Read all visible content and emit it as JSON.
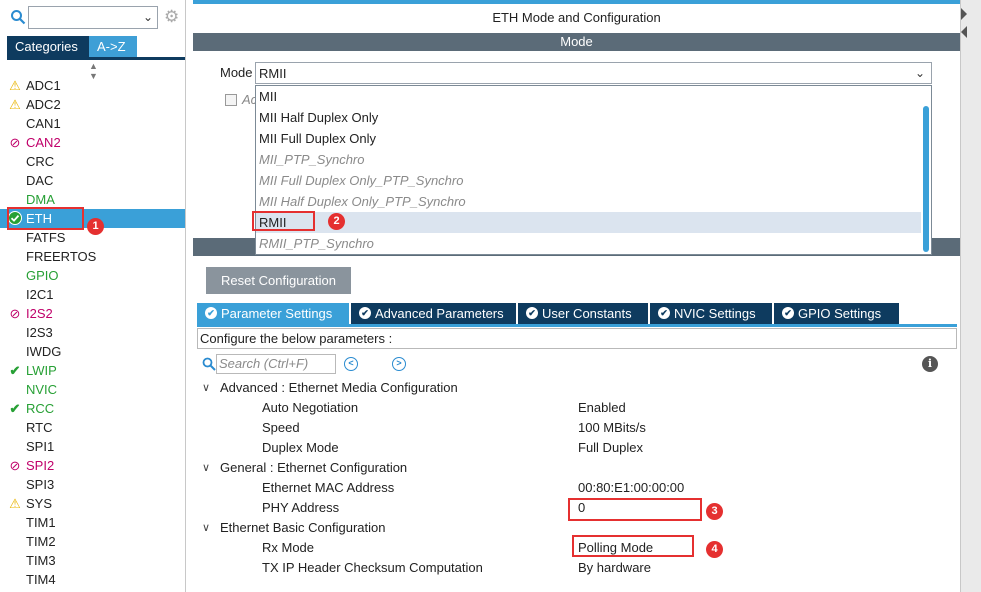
{
  "left_panel": {
    "search": {
      "value": "",
      "placeholder": ""
    },
    "tabs": [
      {
        "label": "Categories"
      },
      {
        "label": "A->Z"
      }
    ],
    "peripherals": [
      {
        "name": "ADC1",
        "status": "warning"
      },
      {
        "name": "ADC2",
        "status": "warning"
      },
      {
        "name": "CAN1",
        "status": "none"
      },
      {
        "name": "CAN2",
        "status": "disabled"
      },
      {
        "name": "CRC",
        "status": "none"
      },
      {
        "name": "DAC",
        "status": "none"
      },
      {
        "name": "DMA",
        "status": "configured-text"
      },
      {
        "name": "ETH",
        "status": "selected-ok"
      },
      {
        "name": "FATFS",
        "status": "none"
      },
      {
        "name": "FREERTOS",
        "status": "none"
      },
      {
        "name": "GPIO",
        "status": "configured-text"
      },
      {
        "name": "I2C1",
        "status": "none"
      },
      {
        "name": "I2S2",
        "status": "disabled"
      },
      {
        "name": "I2S3",
        "status": "none"
      },
      {
        "name": "IWDG",
        "status": "none"
      },
      {
        "name": "LWIP",
        "status": "ok"
      },
      {
        "name": "NVIC",
        "status": "configured-text"
      },
      {
        "name": "RCC",
        "status": "ok"
      },
      {
        "name": "RTC",
        "status": "none"
      },
      {
        "name": "SPI1",
        "status": "none"
      },
      {
        "name": "SPI2",
        "status": "disabled"
      },
      {
        "name": "SPI3",
        "status": "none"
      },
      {
        "name": "SYS",
        "status": "warning"
      },
      {
        "name": "TIM1",
        "status": "none"
      },
      {
        "name": "TIM2",
        "status": "none"
      },
      {
        "name": "TIM3",
        "status": "none"
      },
      {
        "name": "TIM4",
        "status": "none"
      }
    ]
  },
  "main": {
    "title": "ETH Mode and Configuration",
    "mode_header": "Mode",
    "mode_label": "Mode",
    "mode_value": "RMII",
    "behind_text": "Ac",
    "dropdown_options": [
      {
        "label": "MII",
        "italic": false
      },
      {
        "label": "MII Half Duplex Only",
        "italic": false
      },
      {
        "label": "MII Full Duplex Only",
        "italic": false
      },
      {
        "label": "MII_PTP_Synchro",
        "italic": true
      },
      {
        "label": "MII Full Duplex Only_PTP_Synchro",
        "italic": true
      },
      {
        "label": "MII Half Duplex Only_PTP_Synchro",
        "italic": true
      },
      {
        "label": "RMII",
        "italic": false,
        "selected": true
      },
      {
        "label": "RMII_PTP_Synchro",
        "italic": true
      }
    ],
    "reset_button": "Reset Configuration",
    "param_tabs": [
      {
        "label": "Parameter Settings",
        "active": true
      },
      {
        "label": "Advanced Parameters"
      },
      {
        "label": "User Constants"
      },
      {
        "label": "NVIC Settings"
      },
      {
        "label": "GPIO Settings"
      }
    ],
    "configure_text": "Configure the below parameters :",
    "param_search_placeholder": "Search (Ctrl+F)",
    "sections": [
      {
        "title": "Advanced : Ethernet Media Configuration",
        "params": [
          {
            "name": "Auto Negotiation",
            "value": "Enabled"
          },
          {
            "name": "Speed",
            "value": "100 MBits/s"
          },
          {
            "name": "Duplex Mode",
            "value": "Full Duplex"
          }
        ]
      },
      {
        "title": "General : Ethernet Configuration",
        "params": [
          {
            "name": "Ethernet MAC Address",
            "value": "00:80:E1:00:00:00"
          },
          {
            "name": "PHY Address",
            "value": "0"
          }
        ]
      },
      {
        "title": "Ethernet Basic Configuration",
        "params": [
          {
            "name": "Rx Mode",
            "value": "Polling Mode"
          },
          {
            "name": "TX IP Header Checksum Computation",
            "value": "By hardware"
          }
        ]
      }
    ]
  },
  "annotations": {
    "badge_1": "1",
    "badge_2": "2",
    "badge_3": "3",
    "badge_4": "4"
  },
  "colors": {
    "accent": "#3aa0d8",
    "dark_tab": "#0e3b5f",
    "header_bar": "#5b6b78",
    "annotation": "#e53030"
  }
}
